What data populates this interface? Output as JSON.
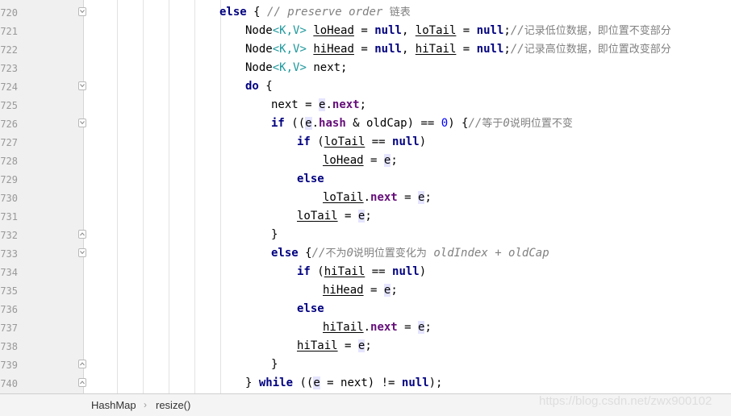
{
  "editor": {
    "lines": [
      {
        "n": "720",
        "fold": "open",
        "indent": 0,
        "tokens": [
          {
            "t": "else",
            "c": "kw"
          },
          {
            "t": " { "
          },
          {
            "t": "// preserve order ",
            "c": "cm"
          },
          {
            "t": "链表",
            "c": "cm cjk"
          }
        ]
      },
      {
        "n": "721",
        "fold": "",
        "indent": 1,
        "tokens": [
          {
            "t": "Node"
          },
          {
            "t": "<",
            "c": "tp"
          },
          {
            "t": "K",
            "c": "tp"
          },
          {
            "t": ",",
            "c": "tp"
          },
          {
            "t": "V",
            "c": "tp"
          },
          {
            "t": ">",
            "c": "tp"
          },
          {
            "t": " "
          },
          {
            "t": "loHead",
            "c": "u"
          },
          {
            "t": " = "
          },
          {
            "t": "null",
            "c": "kw"
          },
          {
            "t": ", "
          },
          {
            "t": "loTail",
            "c": "u"
          },
          {
            "t": " = "
          },
          {
            "t": "null",
            "c": "kw"
          },
          {
            "t": ";"
          },
          {
            "t": "//",
            "c": "cm"
          },
          {
            "t": "记录低位数据，即位置不变部分",
            "c": "cm cjk"
          }
        ]
      },
      {
        "n": "722",
        "fold": "",
        "indent": 1,
        "tokens": [
          {
            "t": "Node"
          },
          {
            "t": "<",
            "c": "tp"
          },
          {
            "t": "K",
            "c": "tp"
          },
          {
            "t": ",",
            "c": "tp"
          },
          {
            "t": "V",
            "c": "tp"
          },
          {
            "t": ">",
            "c": "tp"
          },
          {
            "t": " "
          },
          {
            "t": "hiHead",
            "c": "u"
          },
          {
            "t": " = "
          },
          {
            "t": "null",
            "c": "kw"
          },
          {
            "t": ", "
          },
          {
            "t": "hiTail",
            "c": "u"
          },
          {
            "t": " = "
          },
          {
            "t": "null",
            "c": "kw"
          },
          {
            "t": ";"
          },
          {
            "t": "//",
            "c": "cm"
          },
          {
            "t": "记录高位数据，即位置改变部分",
            "c": "cm cjk"
          }
        ]
      },
      {
        "n": "723",
        "fold": "",
        "indent": 1,
        "tokens": [
          {
            "t": "Node"
          },
          {
            "t": "<",
            "c": "tp"
          },
          {
            "t": "K",
            "c": "tp"
          },
          {
            "t": ",",
            "c": "tp"
          },
          {
            "t": "V",
            "c": "tp"
          },
          {
            "t": ">",
            "c": "tp"
          },
          {
            "t": " next;"
          }
        ]
      },
      {
        "n": "724",
        "fold": "open",
        "indent": 1,
        "tokens": [
          {
            "t": "do",
            "c": "kw"
          },
          {
            "t": " {"
          }
        ]
      },
      {
        "n": "725",
        "fold": "",
        "indent": 2,
        "tokens": [
          {
            "t": "next = "
          },
          {
            "t": "e",
            "c": "hl"
          },
          {
            "t": "."
          },
          {
            "t": "next",
            "c": "fld"
          },
          {
            "t": ";"
          }
        ]
      },
      {
        "n": "726",
        "fold": "open",
        "indent": 2,
        "tokens": [
          {
            "t": "if",
            "c": "kw"
          },
          {
            "t": " (("
          },
          {
            "t": "e",
            "c": "hl"
          },
          {
            "t": "."
          },
          {
            "t": "hash",
            "c": "fld"
          },
          {
            "t": " & oldCap) == "
          },
          {
            "t": "0",
            "c": "num"
          },
          {
            "t": ") {"
          },
          {
            "t": "//",
            "c": "cm"
          },
          {
            "t": "等于",
            "c": "cm cjk"
          },
          {
            "t": "0",
            "c": "cm"
          },
          {
            "t": "说明位置不变",
            "c": "cm cjk"
          }
        ]
      },
      {
        "n": "727",
        "fold": "",
        "indent": 3,
        "tokens": [
          {
            "t": "if",
            "c": "kw"
          },
          {
            "t": " ("
          },
          {
            "t": "loTail",
            "c": "u"
          },
          {
            "t": " == "
          },
          {
            "t": "null",
            "c": "kw"
          },
          {
            "t": ")"
          }
        ]
      },
      {
        "n": "728",
        "fold": "",
        "indent": 4,
        "tokens": [
          {
            "t": "loHead",
            "c": "u"
          },
          {
            "t": " = "
          },
          {
            "t": "e",
            "c": "hl"
          },
          {
            "t": ";"
          }
        ]
      },
      {
        "n": "729",
        "fold": "",
        "indent": 3,
        "tokens": [
          {
            "t": "else",
            "c": "kw"
          }
        ]
      },
      {
        "n": "730",
        "fold": "",
        "indent": 4,
        "tokens": [
          {
            "t": "loTail",
            "c": "u"
          },
          {
            "t": "."
          },
          {
            "t": "next",
            "c": "fld"
          },
          {
            "t": " = "
          },
          {
            "t": "e",
            "c": "hl"
          },
          {
            "t": ";"
          }
        ]
      },
      {
        "n": "731",
        "fold": "",
        "indent": 3,
        "tokens": [
          {
            "t": "loTail",
            "c": "u"
          },
          {
            "t": " = "
          },
          {
            "t": "e",
            "c": "hl"
          },
          {
            "t": ";"
          }
        ]
      },
      {
        "n": "732",
        "fold": "close",
        "indent": 2,
        "tokens": [
          {
            "t": "}"
          }
        ]
      },
      {
        "n": "733",
        "fold": "open",
        "indent": 2,
        "tokens": [
          {
            "t": "else",
            "c": "kw"
          },
          {
            "t": " {"
          },
          {
            "t": "//",
            "c": "cm"
          },
          {
            "t": "不为",
            "c": "cm cjk"
          },
          {
            "t": "0",
            "c": "cm"
          },
          {
            "t": "说明位置变化为",
            "c": "cm cjk"
          },
          {
            "t": " oldIndex + oldCap",
            "c": "cm"
          }
        ]
      },
      {
        "n": "734",
        "fold": "",
        "indent": 3,
        "tokens": [
          {
            "t": "if",
            "c": "kw"
          },
          {
            "t": " ("
          },
          {
            "t": "hiTail",
            "c": "u"
          },
          {
            "t": " == "
          },
          {
            "t": "null",
            "c": "kw"
          },
          {
            "t": ")"
          }
        ]
      },
      {
        "n": "735",
        "fold": "",
        "indent": 4,
        "tokens": [
          {
            "t": "hiHead",
            "c": "u"
          },
          {
            "t": " = "
          },
          {
            "t": "e",
            "c": "hl"
          },
          {
            "t": ";"
          }
        ]
      },
      {
        "n": "736",
        "fold": "",
        "indent": 3,
        "tokens": [
          {
            "t": "else",
            "c": "kw"
          }
        ]
      },
      {
        "n": "737",
        "fold": "",
        "indent": 4,
        "tokens": [
          {
            "t": "hiTail",
            "c": "u"
          },
          {
            "t": "."
          },
          {
            "t": "next",
            "c": "fld"
          },
          {
            "t": " = "
          },
          {
            "t": "e",
            "c": "hl"
          },
          {
            "t": ";"
          }
        ]
      },
      {
        "n": "738",
        "fold": "",
        "indent": 3,
        "tokens": [
          {
            "t": "hiTail",
            "c": "u"
          },
          {
            "t": " = "
          },
          {
            "t": "e",
            "c": "hl"
          },
          {
            "t": ";"
          }
        ]
      },
      {
        "n": "739",
        "fold": "close",
        "indent": 2,
        "tokens": [
          {
            "t": "}"
          }
        ]
      },
      {
        "n": "740",
        "fold": "close",
        "indent": 1,
        "tokens": [
          {
            "t": "} "
          },
          {
            "t": "while",
            "c": "kw"
          },
          {
            "t": " (("
          },
          {
            "t": "e",
            "c": "hl"
          },
          {
            "t": " = next) != "
          },
          {
            "t": "null",
            "c": "kw"
          },
          {
            "t": ");"
          }
        ]
      }
    ]
  },
  "breadcrumb": {
    "items": [
      "HashMap",
      "resize()"
    ],
    "separator": "›"
  },
  "watermark": "https://blog.csdn.net/zwx900102",
  "colors": {
    "keyword": "#000080",
    "field": "#660e7a",
    "number": "#0000ff",
    "comment": "#808080",
    "type_param": "#20999d",
    "identifier_highlight": "#e4e4ff",
    "gutter": "#f0f0f0"
  }
}
